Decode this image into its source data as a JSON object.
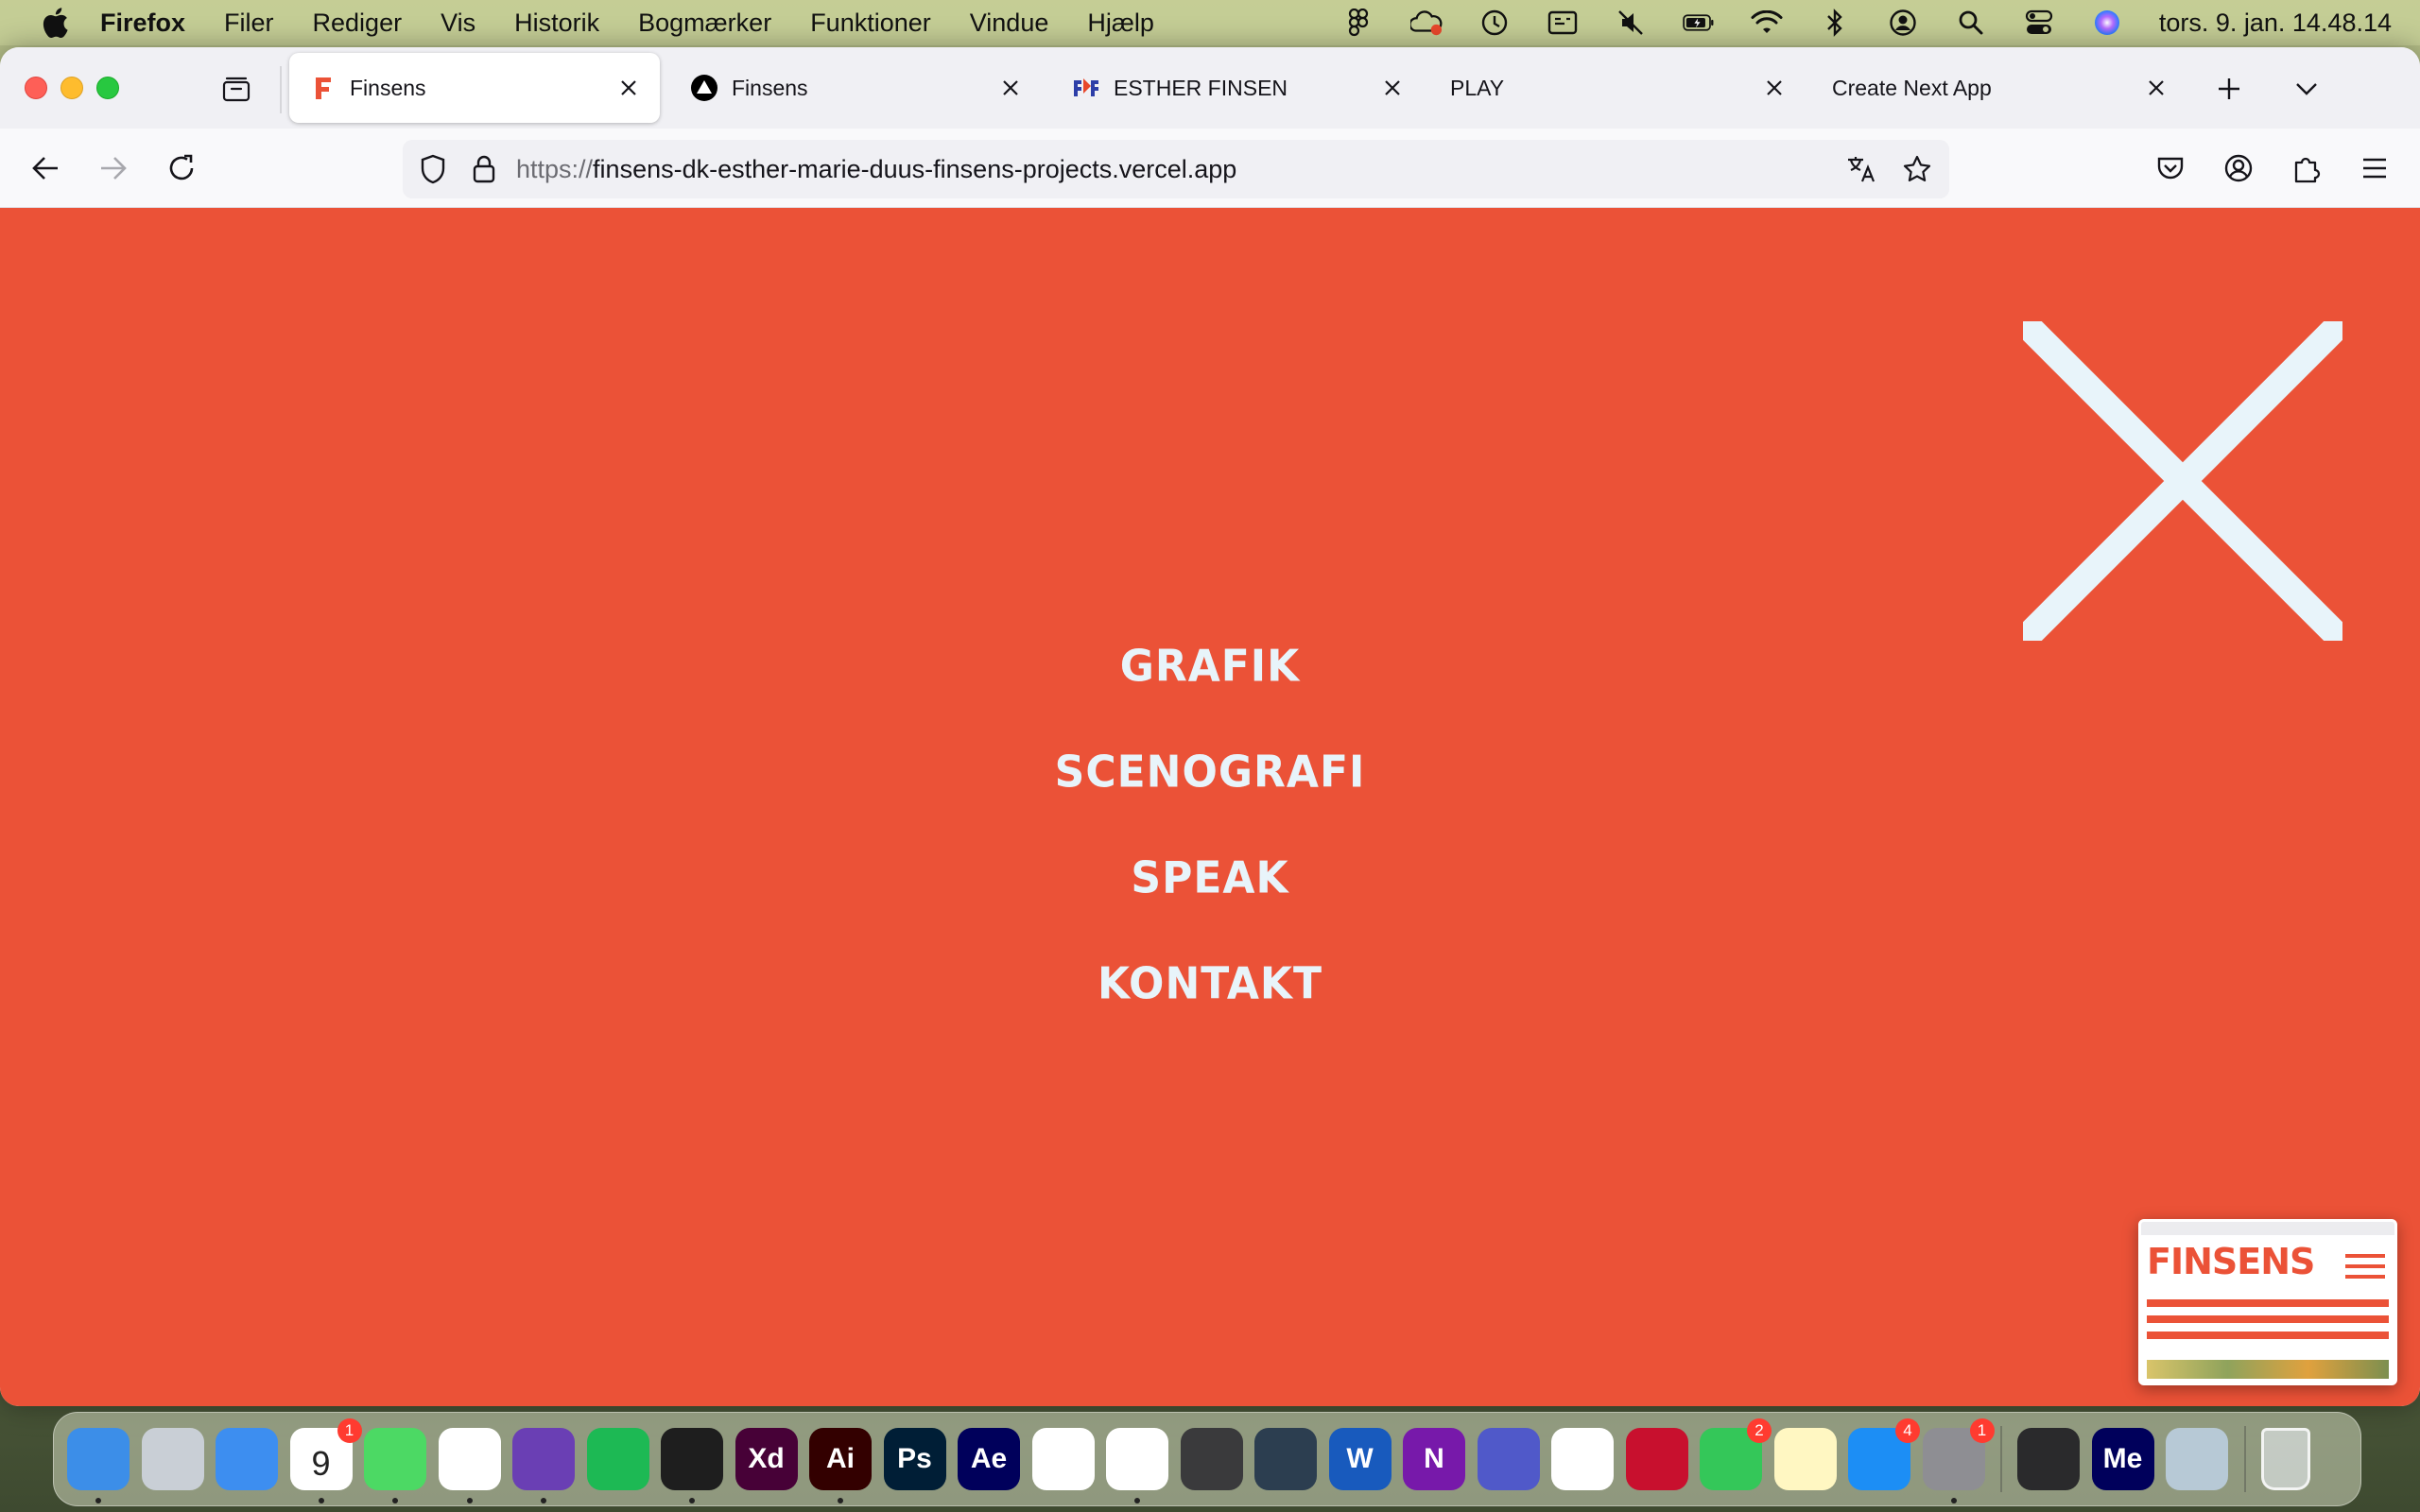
{
  "menubar": {
    "app_name": "Firefox",
    "items": [
      "Filer",
      "Rediger",
      "Vis",
      "Historik",
      "Bogmærker",
      "Funktioner",
      "Vindue",
      "Hjælp"
    ],
    "clock": "tors. 9. jan.  14.48.14",
    "status_icons": [
      "figma-icon",
      "creative-cloud-icon",
      "timemachine-icon",
      "display-icon",
      "mute-icon",
      "battery-icon",
      "wifi-icon",
      "bluetooth-icon",
      "user-icon",
      "spotlight-icon",
      "control-center-icon",
      "siri-icon"
    ]
  },
  "browser": {
    "tabs": [
      {
        "title": "Finsens",
        "favicon": "finsens-f-icon",
        "active": true
      },
      {
        "title": "Finsens",
        "favicon": "vercel-triangle-icon",
        "active": false
      },
      {
        "title": "ESTHER FINSEN",
        "favicon": "esther-finsen-icon",
        "active": false
      },
      {
        "title": "PLAY",
        "favicon": "",
        "active": false
      },
      {
        "title": "Create Next App",
        "favicon": "",
        "active": false
      }
    ],
    "url_protocol": "https://",
    "url_host": "finsens-dk-esther-marie-duus-finsens-projects.vercel.app"
  },
  "page": {
    "background": "#eb5237",
    "text_color": "#e8f4fa",
    "menu_links": [
      "GRAFIK",
      "SCENOGRAFI",
      "SPEAK",
      "KONTAKT"
    ],
    "thumbnail_logo": "FINSENS"
  },
  "dock": {
    "apps": [
      {
        "name": "finder",
        "label": "",
        "bg": "#3c8ee8",
        "badge": "",
        "running": true
      },
      {
        "name": "launchpad",
        "label": "",
        "bg": "#c9cfd6",
        "badge": "",
        "running": false
      },
      {
        "name": "mail",
        "label": "",
        "bg": "#3d8ef0",
        "badge": "",
        "running": false
      },
      {
        "name": "calendar",
        "label": "9",
        "bg": "#ffffff",
        "badge": "1",
        "running": true
      },
      {
        "name": "messages",
        "label": "",
        "bg": "#4cd964",
        "badge": "",
        "running": true
      },
      {
        "name": "chrome",
        "label": "",
        "bg": "#ffffff",
        "badge": "",
        "running": true
      },
      {
        "name": "firefox",
        "label": "",
        "bg": "#6a3fb4",
        "badge": "",
        "running": true
      },
      {
        "name": "spotify",
        "label": "",
        "bg": "#1db954",
        "badge": "",
        "running": false
      },
      {
        "name": "figma",
        "label": "",
        "bg": "#1e1e1e",
        "badge": "",
        "running": true
      },
      {
        "name": "adobe-xd",
        "label": "Xd",
        "bg": "#470137",
        "badge": "",
        "running": false
      },
      {
        "name": "illustrator",
        "label": "Ai",
        "bg": "#330000",
        "badge": "",
        "running": true
      },
      {
        "name": "photoshop",
        "label": "Ps",
        "bg": "#001e36",
        "badge": "",
        "running": false
      },
      {
        "name": "after-effects",
        "label": "Ae",
        "bg": "#00005b",
        "badge": "",
        "running": false
      },
      {
        "name": "creative-cloud",
        "label": "",
        "bg": "#ffffff",
        "badge": "",
        "running": false
      },
      {
        "name": "vscode",
        "label": "",
        "bg": "#ffffff",
        "badge": "",
        "running": true
      },
      {
        "name": "safari-dev",
        "label": "",
        "bg": "#3a3a3c",
        "badge": "",
        "running": false
      },
      {
        "name": "paper-plane",
        "label": "",
        "bg": "#2c3e50",
        "badge": "",
        "running": false
      },
      {
        "name": "word",
        "label": "W",
        "bg": "#185abd",
        "badge": "",
        "running": false
      },
      {
        "name": "onenote",
        "label": "N",
        "bg": "#7719aa",
        "badge": "",
        "running": false
      },
      {
        "name": "teams",
        "label": "",
        "bg": "#5059c9",
        "badge": "",
        "running": false
      },
      {
        "name": "photos",
        "label": "",
        "bg": "#ffffff",
        "badge": "",
        "running": false
      },
      {
        "name": "photo-booth",
        "label": "",
        "bg": "#c8102e",
        "badge": "",
        "running": false
      },
      {
        "name": "facetime",
        "label": "",
        "bg": "#34c759",
        "badge": "2",
        "running": false
      },
      {
        "name": "notes",
        "label": "",
        "bg": "#fff7c2",
        "badge": "",
        "running": false
      },
      {
        "name": "app-store",
        "label": "",
        "bg": "#1c8ef5",
        "badge": "4",
        "running": false
      },
      {
        "name": "system-settings",
        "label": "",
        "bg": "#8e8e93",
        "badge": "1",
        "running": true
      },
      {
        "name": "quicktime",
        "label": "",
        "bg": "#2a2a2c",
        "badge": "",
        "running": false
      },
      {
        "name": "media-encoder",
        "label": "Me",
        "bg": "#00005b",
        "badge": "",
        "running": false
      },
      {
        "name": "preview",
        "label": "",
        "bg": "#b7c9d6",
        "badge": "",
        "running": false
      },
      {
        "name": "trash",
        "label": "",
        "bg": "transparent",
        "badge": "",
        "running": false
      }
    ]
  }
}
